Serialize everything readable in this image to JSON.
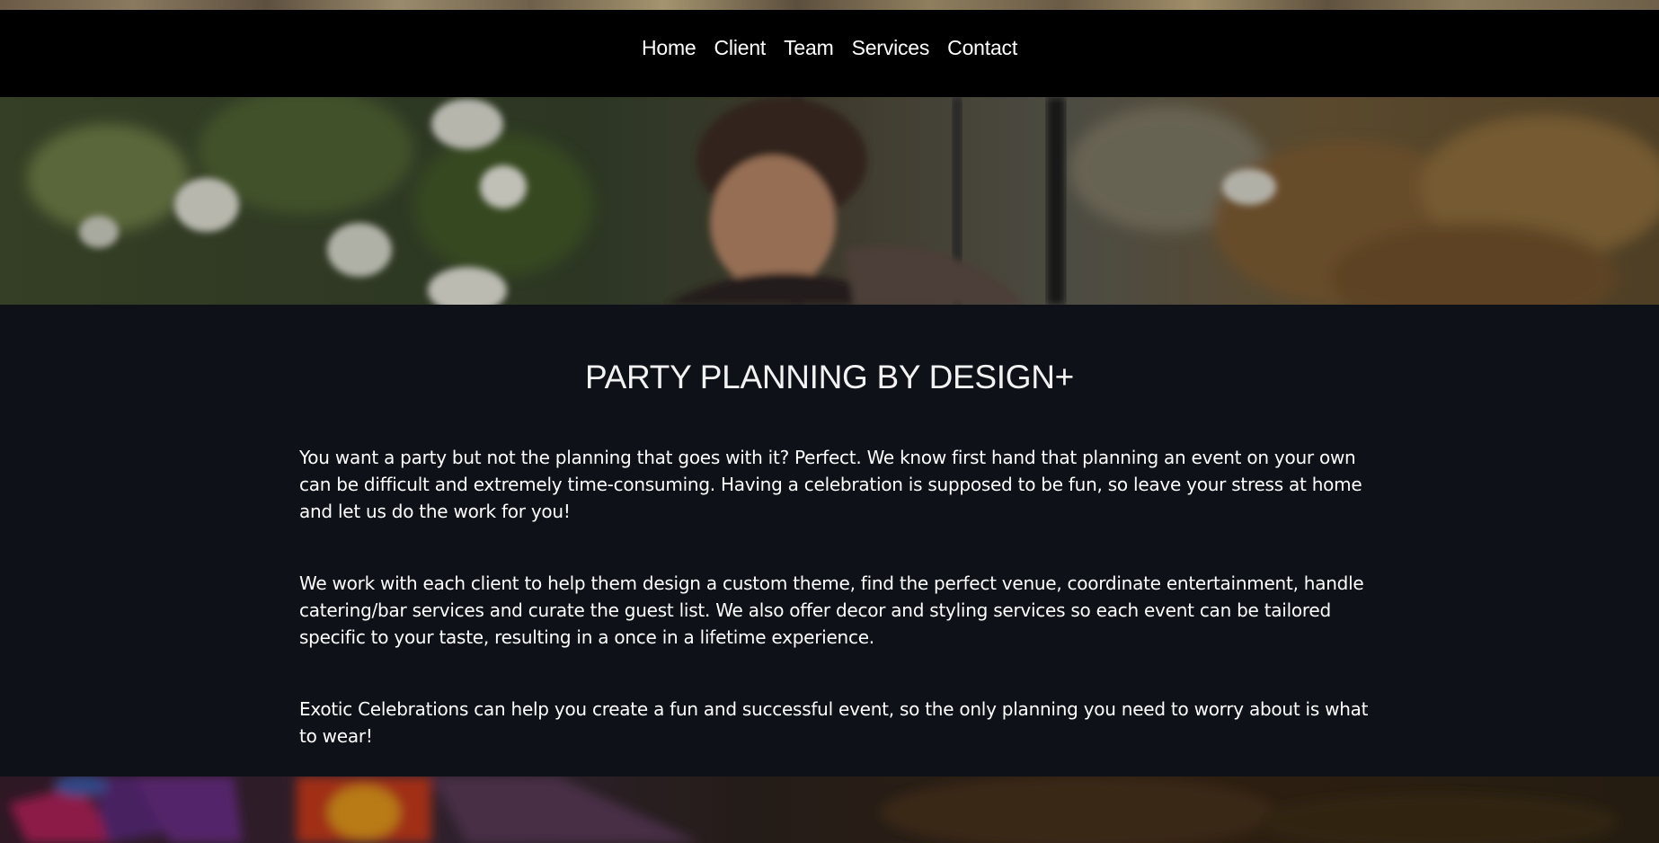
{
  "nav": {
    "items": [
      {
        "label": "Home"
      },
      {
        "label": "Client"
      },
      {
        "label": "Team"
      },
      {
        "label": "Services"
      },
      {
        "label": "Contact"
      }
    ]
  },
  "main": {
    "title": "PARTY PLANNING BY DESIGN+",
    "paragraphs": [
      "You want a party but not the planning that goes with it? Perfect. We know first hand that planning an event on your own can be difficult and extremely time-consuming. Having a celebration is supposed to be fun, so leave your stress at home and let us do the work for you!",
      "We work with each client to help them design a custom theme, find the perfect venue, coordinate entertainment, handle catering/bar services and curate the guest list. We also offer decor and styling services so each event can be tailored specific to your taste, resulting in a once in a lifetime experience.",
      "Exotic Celebrations can help you create a fun and successful event, so the only planning you need to worry about is what to wear!"
    ]
  },
  "colors": {
    "navbar_bg": "#000000",
    "content_bg": "#0e1118",
    "text": "#ffffff"
  }
}
